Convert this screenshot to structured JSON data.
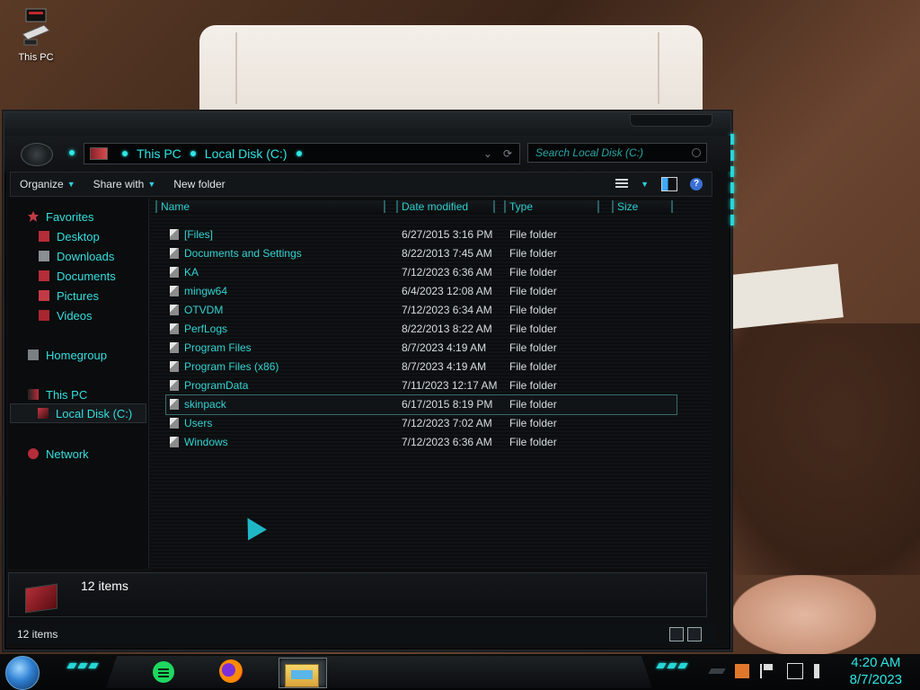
{
  "desktop": {
    "icon_label": "This PC"
  },
  "window": {
    "address": {
      "crumbs": [
        "This PC",
        "Local Disk (C:)"
      ]
    },
    "search": {
      "placeholder": "Search Local Disk (C:)"
    },
    "toolbar": {
      "organize": "Organize",
      "share_with": "Share with",
      "new_folder": "New folder"
    },
    "nav": {
      "favorites": "Favorites",
      "desktop": "Desktop",
      "downloads": "Downloads",
      "documents": "Documents",
      "pictures": "Pictures",
      "videos": "Videos",
      "homegroup": "Homegroup",
      "this_pc": "This PC",
      "local_disk": "Local Disk (C:)",
      "network": "Network"
    },
    "columns": {
      "name": "Name",
      "date": "Date modified",
      "type": "Type",
      "size": "Size"
    },
    "files": [
      {
        "name": "[Files]",
        "date": "6/27/2015 3:16 PM",
        "type": "File folder"
      },
      {
        "name": "Documents and Settings",
        "date": "8/22/2013 7:45 AM",
        "type": "File folder"
      },
      {
        "name": "KA",
        "date": "7/12/2023 6:36 AM",
        "type": "File folder"
      },
      {
        "name": "mingw64",
        "date": "6/4/2023 12:08 AM",
        "type": "File folder"
      },
      {
        "name": "OTVDM",
        "date": "7/12/2023 6:34 AM",
        "type": "File folder"
      },
      {
        "name": "PerfLogs",
        "date": "8/22/2013 8:22 AM",
        "type": "File folder"
      },
      {
        "name": "Program Files",
        "date": "8/7/2023 4:19 AM",
        "type": "File folder"
      },
      {
        "name": "Program Files (x86)",
        "date": "8/7/2023 4:19 AM",
        "type": "File folder"
      },
      {
        "name": "ProgramData",
        "date": "7/11/2023 12:17 AM",
        "type": "File folder"
      },
      {
        "name": "skinpack",
        "date": "6/17/2015 8:19 PM",
        "type": "File folder"
      },
      {
        "name": "Users",
        "date": "7/12/2023 7:02 AM",
        "type": "File folder"
      },
      {
        "name": "Windows",
        "date": "7/12/2023 6:36 AM",
        "type": "File folder"
      }
    ],
    "details_count": "12 items",
    "status_count": "12 items"
  },
  "taskbar": {
    "time": "4:20 AM",
    "date": "8/7/2023"
  },
  "colors": {
    "accent": "#2ee6e6",
    "window_bg": "#0d0f11"
  }
}
